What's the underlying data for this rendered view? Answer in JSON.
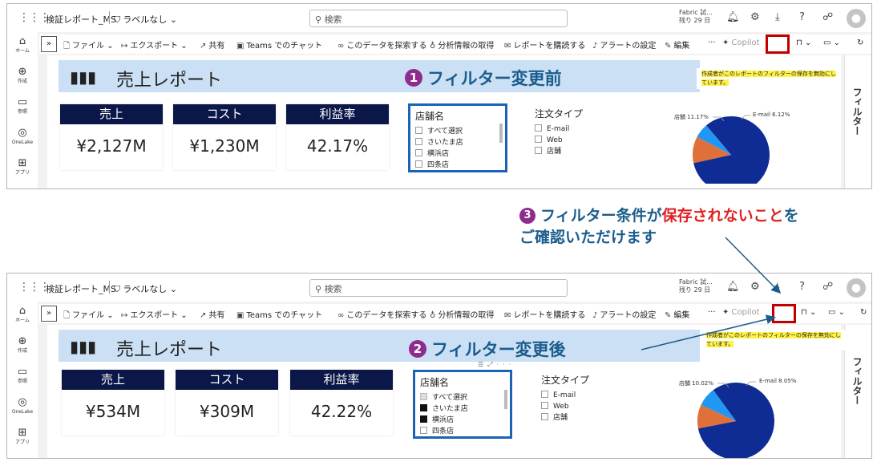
{
  "app": {
    "report_name": "検証レポート_MS",
    "sensitivity_label": "ラベルなし",
    "search_placeholder": "検索",
    "trial_line1": "Fabric 試...",
    "trial_line2": "残り 29 日"
  },
  "nav": [
    {
      "label": "ホーム",
      "icon": "home-icon"
    },
    {
      "label": "作成",
      "icon": "plus-circle-icon"
    },
    {
      "label": "参照",
      "icon": "folder-icon"
    },
    {
      "label": "OneLake",
      "icon": "onelake-icon"
    },
    {
      "label": "アプリ",
      "icon": "apps-icon"
    }
  ],
  "actions": {
    "collapse": "»",
    "file": "ファイル",
    "export": "エクスポート",
    "share": "共有",
    "teams": "Teams でのチャット",
    "explore": "このデータを探索する",
    "insights": "分析情報の取得",
    "subscribe": "レポートを購読する",
    "alert": "アラートの設定",
    "edit": "編集",
    "more": "···",
    "copilot": "Copilot"
  },
  "tooltip": "作成者がこのレポートのフィルターの保存を無効にしています。",
  "filter_pane_title": "フィルター",
  "report_title": "売上レポート",
  "kpi_labels": {
    "sales": "売上",
    "cost": "コスト",
    "margin": "利益率"
  },
  "before": {
    "step_number": "1",
    "step_label": "フィルター変更前",
    "sales": "¥2,127M",
    "cost": "¥1,230M",
    "margin": "42.17%",
    "pie_label_store": "店舗 11.17%",
    "pie_label_email": "E-mail 6.12%"
  },
  "after": {
    "step_number": "2",
    "step_label": "フィルター変更後",
    "sales": "¥534M",
    "cost": "¥309M",
    "margin": "42.22%",
    "pie_label_store": "店舗 10.02%",
    "pie_label_email": "E-mail 8.05%"
  },
  "store_slicer": {
    "title": "店舗名",
    "items": [
      "すべて選択",
      "さいたま店",
      "横浜店",
      "四条店"
    ],
    "header_icons": "☰⤢···"
  },
  "order_type_slicer": {
    "title": "注文タイプ",
    "items": [
      "E-mail",
      "Web",
      "店舗"
    ]
  },
  "note": {
    "number": "3",
    "line1_prefix": "フィルター条件が",
    "line1_red": "保存されないこと",
    "line1_suffix": "を",
    "line2": "ご確認いただけます"
  },
  "colors": {
    "kpi_header": "#0b1649",
    "banner": "#cbe0f5",
    "pie_web": "#0f2c95",
    "pie_store": "#e0703a",
    "pie_email": "#2196f3",
    "highlight_red": "#c00000",
    "step_text": "#1b5d8c",
    "step_badge": "#8e2c8e"
  },
  "chart_data": [
    {
      "type": "pie",
      "title": "",
      "categories": [
        "Web",
        "店舗",
        "E-mail"
      ],
      "values": [
        82.71,
        11.17,
        6.12
      ]
    },
    {
      "type": "pie",
      "title": "",
      "categories": [
        "Web",
        "店舗",
        "E-mail"
      ],
      "values": [
        81.93,
        10.02,
        8.05
      ]
    }
  ]
}
